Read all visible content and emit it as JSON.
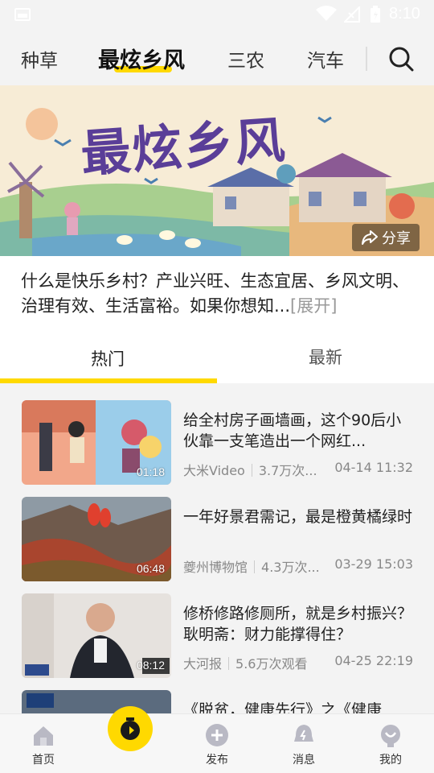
{
  "status_bar": {
    "time": "8:10"
  },
  "top_tabs": [
    {
      "label": "种草"
    },
    {
      "label": "最炫乡风"
    },
    {
      "label": "三农"
    },
    {
      "label": "汽车"
    }
  ],
  "banner": {
    "title": "最炫乡风",
    "share_label": "分享"
  },
  "description": {
    "text": "什么是快乐乡村？产业兴旺、生态宜居、乡风文明、治理有效、生活富裕。如果你想知...",
    "more": "[展开]"
  },
  "sub_tabs": [
    {
      "label": "热门"
    },
    {
      "label": "最新"
    }
  ],
  "videos": [
    {
      "title": "给全村房子画墙画，这个90后小伙靠一支笔造出一个网红...",
      "duration": "01:18",
      "source": "大米Video",
      "views": "3.7万次...",
      "date": "04-14 11:32"
    },
    {
      "title": "一年好景君需记，最是橙黄橘绿时",
      "duration": "06:48",
      "source": "夔州博物馆",
      "views": "4.3万次...",
      "date": "03-29 15:03"
    },
    {
      "title": "修桥修路修厕所，就是乡村振兴？耿明斋：财力能撑得住？",
      "duration": "08:12",
      "source": "大河报",
      "views": "5.6万次观看",
      "date": "04-25 22:19"
    },
    {
      "title": "《脱贫，健康先行》之《健康"
    }
  ],
  "bottom_nav": [
    {
      "label": "首页",
      "icon": "home-icon"
    },
    {
      "label": "",
      "icon": "camera-record-icon"
    },
    {
      "label": "发布",
      "icon": "plus-icon"
    },
    {
      "label": "消息",
      "icon": "bell-icon"
    },
    {
      "label": "我的",
      "icon": "profile-icon"
    }
  ],
  "colors": {
    "accent": "#ffd900",
    "text": "#222222",
    "muted": "#888888"
  }
}
